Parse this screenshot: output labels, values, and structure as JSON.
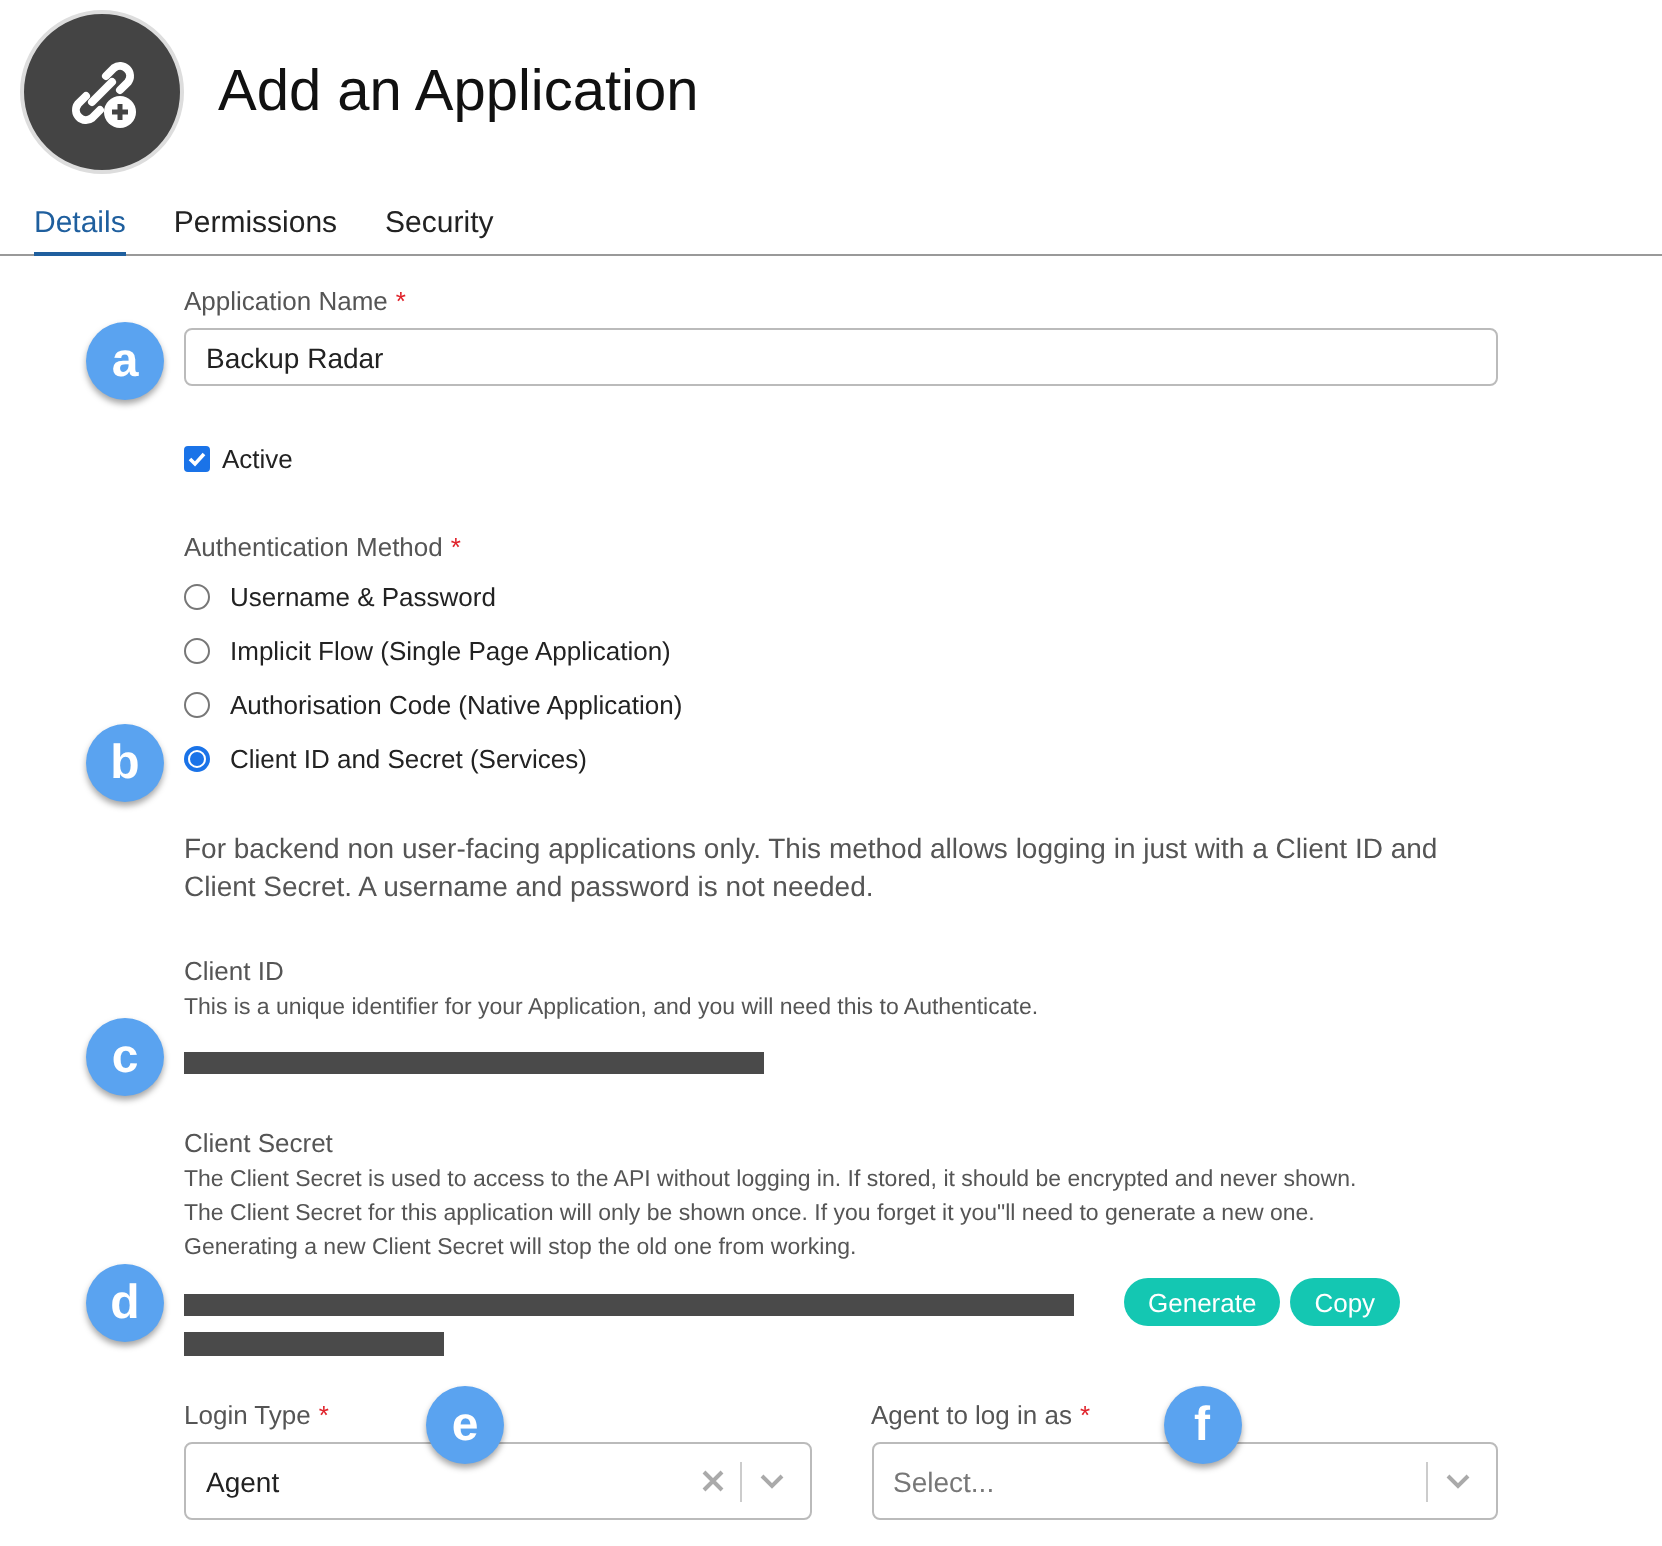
{
  "header": {
    "title": "Add an Application"
  },
  "tabs": [
    {
      "label": "Details",
      "selected": true
    },
    {
      "label": "Permissions",
      "selected": false
    },
    {
      "label": "Security",
      "selected": false
    }
  ],
  "application_name": {
    "marker": "a",
    "label": "Application Name",
    "required_mark": "*",
    "value": "Backup Radar"
  },
  "active": {
    "label": "Active",
    "checked": true
  },
  "authentication_method": {
    "marker": "b",
    "label": "Authentication Method",
    "required_mark": "*",
    "options": [
      {
        "label": "Username & Password",
        "selected": false
      },
      {
        "label": "Implicit Flow (Single Page Application)",
        "selected": false
      },
      {
        "label": "Authorisation Code (Native Application)",
        "selected": false
      },
      {
        "label": "Client ID and Secret (Services)",
        "selected": true
      }
    ],
    "description": "For backend non user-facing applications only. This method allows logging in just with a Client ID and Client Secret. A username and password is not needed."
  },
  "client_id": {
    "marker": "c",
    "label": "Client ID",
    "help": "This is a unique identifier for your Application, and you will need this to Authenticate."
  },
  "client_secret": {
    "marker": "d",
    "label": "Client Secret",
    "help": [
      "The Client Secret is used to access to the API without logging in. If stored, it should be encrypted and never shown.",
      "The Client Secret for this application will only be shown once. If you forget it you\"ll need to generate a new one.",
      "Generating a new Client Secret will stop the old one from working."
    ],
    "buttons": [
      "Generate",
      "Copy"
    ]
  },
  "login_type": {
    "marker": "e",
    "label": "Login Type",
    "required_mark": "*",
    "value": "Agent",
    "clearable": true
  },
  "agent": {
    "marker": "f",
    "label": "Agent to log in as",
    "required_mark": "*",
    "placeholder": "Select..."
  }
}
